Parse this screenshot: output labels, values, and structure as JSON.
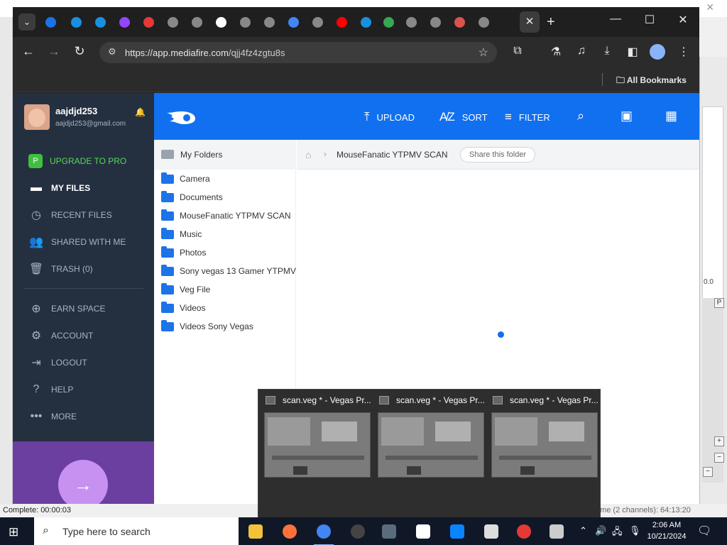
{
  "chrome": {
    "tab_search_icon": "chevron-down-icon",
    "new_tab": "+",
    "close_tab": "✕",
    "minimize": "—",
    "maximize": "☐",
    "close": "✕",
    "url_host": "https://app.mediafire.com",
    "url_path": "/qjj4fz4zgtu8s",
    "bookmarks_folder": "All Bookmarks",
    "tab_favicon_colors": [
      "#1a73e8",
      "#1a8fe0",
      "#1a8fe0",
      "#9146ff",
      "#e53935",
      "#888888",
      "#888888",
      "#ffffff",
      "#888888",
      "#888888",
      "#4285f4",
      "#888888",
      "#ff0000",
      "#1a8fe0",
      "#34a853",
      "#888888",
      "#888888",
      "#d9534f",
      "#888888"
    ]
  },
  "user": {
    "name": "aajdjd253",
    "email": "aajdjd253@gmail.com"
  },
  "sidebar": {
    "items": [
      {
        "label": "UPGRADE TO PRO",
        "icon": "upgrade-icon"
      },
      {
        "label": "MY FILES",
        "icon": "folder-icon"
      },
      {
        "label": "RECENT FILES",
        "icon": "clock-icon"
      },
      {
        "label": "SHARED WITH ME",
        "icon": "people-icon"
      },
      {
        "label": "TRASH (0)",
        "icon": "trash-icon"
      },
      {
        "label": "EARN SPACE",
        "icon": "plus-circle-icon"
      },
      {
        "label": "ACCOUNT",
        "icon": "gear-icon"
      },
      {
        "label": "LOGOUT",
        "icon": "logout-icon"
      },
      {
        "label": "HELP",
        "icon": "help-icon"
      },
      {
        "label": "MORE",
        "icon": "more-icon"
      }
    ]
  },
  "actions": {
    "upload": "UPLOAD",
    "sort": "SORT",
    "filter": "FILTER"
  },
  "folders": {
    "header": "My Folders",
    "items": [
      "Camera",
      "Documents",
      "MouseFanatic YTPMV SCAN",
      "Music",
      "Photos",
      "Sony vegas 13 Gamer YTPMV",
      "Veg File",
      "Videos",
      "Videos Sony Vegas"
    ]
  },
  "breadcrumb": {
    "current": "MouseFanatic YTPMV SCAN",
    "share": "Share this folder"
  },
  "preview": {
    "windows": [
      "scan.veg * - Vegas Pr...",
      "scan.veg * - Vegas Pr...",
      "scan.veg * - Vegas Pr..."
    ]
  },
  "background_app": {
    "status_left": "Complete: 00:00:03",
    "status_right": "Record Time (2 channels): 64:13:20",
    "right_value": "0.0"
  },
  "taskbar": {
    "search_placeholder": "Type here to search",
    "time": "2:06 AM",
    "date": "10/21/2024",
    "apps": [
      {
        "name": "file-explorer-icon",
        "color": "#f3c13a"
      },
      {
        "name": "firefox-icon",
        "color": "#ff7139"
      },
      {
        "name": "chrome-icon",
        "color": "#4285f4"
      },
      {
        "name": "obs-icon",
        "color": "#444444"
      },
      {
        "name": "vegas-icon",
        "color": "#5a6b7b"
      },
      {
        "name": "7zip-icon",
        "color": "#ffffff"
      },
      {
        "name": "onedrive-icon",
        "color": "#0a84ff"
      },
      {
        "name": "app-icon",
        "color": "#dddddd"
      },
      {
        "name": "record-icon",
        "color": "#e53935"
      },
      {
        "name": "cloud-icon",
        "color": "#cccccc"
      }
    ]
  }
}
